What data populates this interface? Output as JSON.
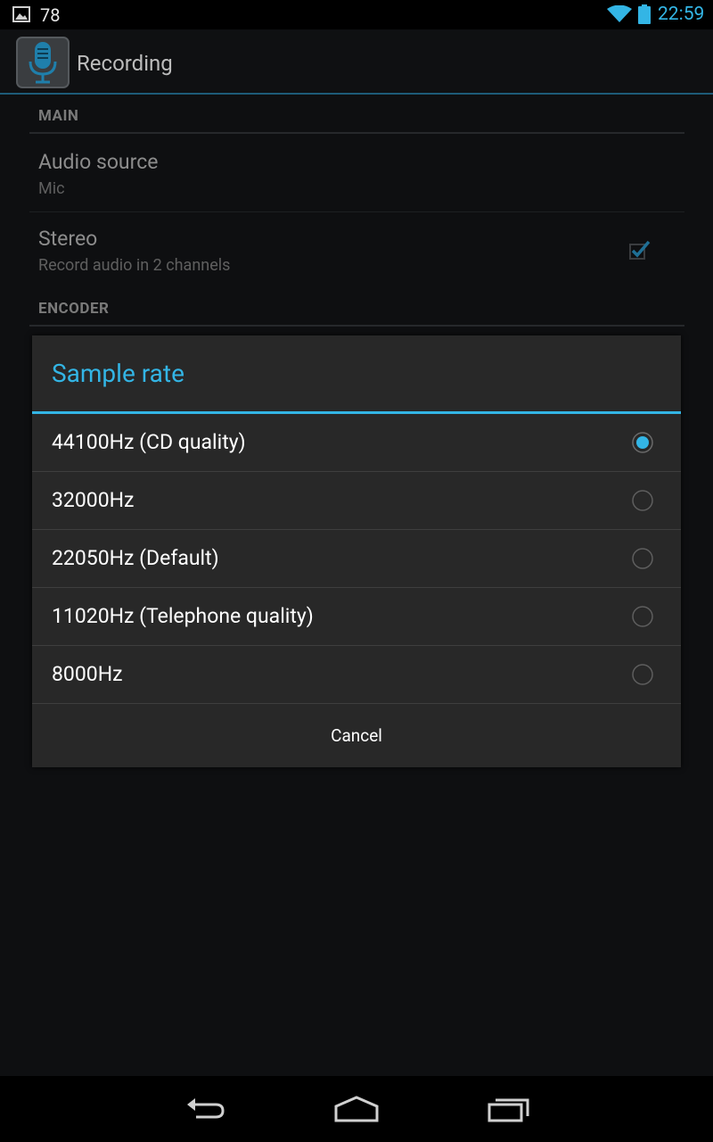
{
  "status_bar": {
    "notification_count": "78",
    "time": "22:59",
    "icons": [
      "image-notification-icon",
      "wifi-icon",
      "battery-icon"
    ]
  },
  "action_bar": {
    "title": "Recording",
    "icon": "microphone-icon"
  },
  "preferences": {
    "main_category": "MAIN",
    "audio_source": {
      "title": "Audio source",
      "summary": "Mic"
    },
    "stereo": {
      "title": "Stereo",
      "summary": "Record audio in 2 channels",
      "checked": true
    },
    "encoder_category": "ENCODER"
  },
  "dialog": {
    "title": "Sample rate",
    "options": [
      {
        "label": "44100Hz (CD quality)",
        "selected": true
      },
      {
        "label": "32000Hz",
        "selected": false
      },
      {
        "label": "22050Hz (Default)",
        "selected": false
      },
      {
        "label": "11020Hz (Telephone quality)",
        "selected": false
      },
      {
        "label": "8000Hz",
        "selected": false
      }
    ],
    "cancel_label": "Cancel"
  },
  "nav_bar": {
    "icons": [
      "back-icon",
      "home-icon",
      "recent-apps-icon"
    ]
  },
  "colors": {
    "accent": "#33b5e5",
    "dialog_bg": "#282828",
    "background": "#0c0d0f"
  }
}
